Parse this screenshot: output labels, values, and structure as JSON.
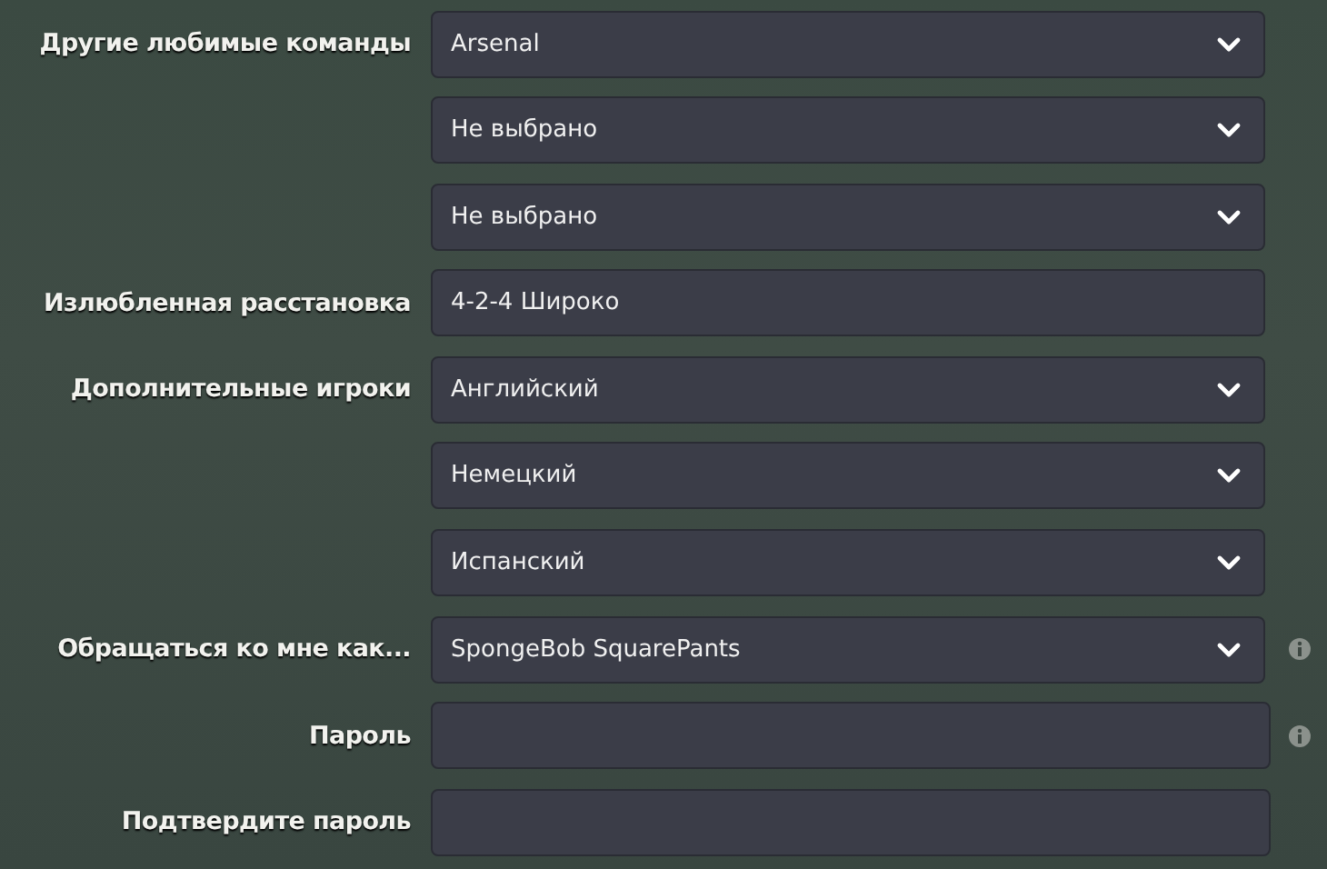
{
  "rows": [
    {
      "label": "Другие любимые команды",
      "kind": "dropdown",
      "value": "Arsenal",
      "info": false
    },
    {
      "kind": "dropdown",
      "value": "Не выбрано",
      "info": false
    },
    {
      "kind": "dropdown",
      "value": "Не выбрано",
      "info": false
    },
    {
      "label": "Излюбленная расстановка",
      "kind": "text",
      "value": "4-2-4 Широко",
      "info": false
    },
    {
      "label": "Дополнительные игроки",
      "kind": "dropdown",
      "value": "Английский",
      "info": false
    },
    {
      "kind": "dropdown",
      "value": "Немецкий",
      "info": false
    },
    {
      "kind": "dropdown",
      "value": "Испанский",
      "info": false
    },
    {
      "label": "Обращаться ко мне как...",
      "kind": "dropdown",
      "value": "SpongeBob SquarePants",
      "info": true
    },
    {
      "label": "Пароль",
      "kind": "password",
      "info": true
    },
    {
      "label": "Подтвердите пароль",
      "kind": "password",
      "info": false
    }
  ]
}
